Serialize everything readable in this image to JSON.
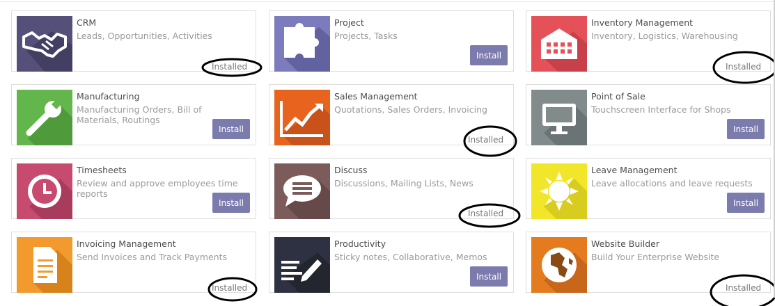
{
  "apps": [
    {
      "name": "CRM",
      "desc": "Leads, Opportunities, Activities",
      "status": "installed",
      "color": "#55507a"
    },
    {
      "name": "Project",
      "desc": "Projects, Tasks",
      "status": "install",
      "color": "#7b7bbd"
    },
    {
      "name": "Inventory Management",
      "desc": "Inventory, Logistics, Warehousing",
      "status": "installed",
      "color": "#e45159"
    },
    {
      "name": "Manufacturing",
      "desc": "Manufacturing Orders, Bill of Materials, Routings",
      "status": "install",
      "color": "#63b64b"
    },
    {
      "name": "Sales Management",
      "desc": "Quotations, Sales Orders, Invoicing",
      "status": "installed",
      "color": "#e8641e"
    },
    {
      "name": "Point of Sale",
      "desc": "Touchscreen Interface for Shops",
      "status": "install",
      "color": "#818b8b"
    },
    {
      "name": "Timesheets",
      "desc": "Review and approve employees time reports",
      "status": "install",
      "color": "#c74a6f"
    },
    {
      "name": "Discuss",
      "desc": "Discussions, Mailing Lists, News",
      "status": "installed",
      "color": "#7c5c5a"
    },
    {
      "name": "Leave Management",
      "desc": "Leave allocations and leave requests",
      "status": "install",
      "color": "#f2e62a"
    },
    {
      "name": "Invoicing Management",
      "desc": "Send Invoices and Track Payments",
      "status": "installed",
      "color": "#f29a2e"
    },
    {
      "name": "Productivity",
      "desc": "Sticky notes, Collaborative, Memos",
      "status": "install",
      "color": "#2e3141"
    },
    {
      "name": "Website Builder",
      "desc": "Build Your Enterprise Website",
      "status": "installed",
      "color": "#e47b1e"
    }
  ],
  "labels": {
    "install": "Install",
    "installed": "Installed"
  }
}
